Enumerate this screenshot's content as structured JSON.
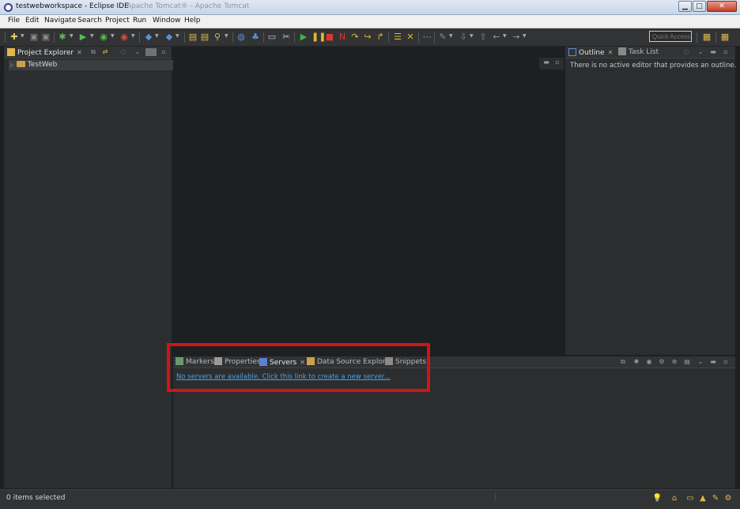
{
  "window": {
    "title": "testwebworkspace - Eclipse IDE",
    "background_title": "Apache Tomcat® - Apache Tomcat",
    "minimize_glyph": "▁",
    "maximize_glyph": "□",
    "close_glyph": "✕"
  },
  "menu": {
    "items": [
      {
        "label": "File"
      },
      {
        "label": "Edit"
      },
      {
        "label": "Navigate"
      },
      {
        "label": "Search"
      },
      {
        "label": "Project"
      },
      {
        "label": "Run"
      },
      {
        "label": "Window"
      },
      {
        "label": "Help"
      }
    ]
  },
  "toolbar": {
    "quick_access_placeholder": "Quick Access",
    "icons": [
      {
        "name": "new-icon",
        "glyph": "✚",
        "color": "#e9c46a"
      },
      {
        "name": "save-icon",
        "glyph": "▣",
        "color": "#8a8a8a"
      },
      {
        "name": "save-all-icon",
        "glyph": "▣",
        "color": "#8a8a8a"
      },
      {
        "name": "debug-icon",
        "glyph": "✱",
        "color": "#58b85a"
      },
      {
        "name": "run-icon",
        "glyph": "▶",
        "color": "#58b85a"
      },
      {
        "name": "coverage-icon",
        "glyph": "◉",
        "color": "#58b85a"
      },
      {
        "name": "external-tools-icon",
        "glyph": "◉",
        "color": "#d94f3a"
      },
      {
        "name": "new-server-icon",
        "glyph": "◆",
        "color": "#5d8fd6"
      },
      {
        "name": "new-class-icon",
        "glyph": "◆",
        "color": "#5d8fd6"
      },
      {
        "name": "open-type-icon",
        "glyph": "▤",
        "color": "#e0b84a"
      },
      {
        "name": "open-task-icon",
        "glyph": "▤",
        "color": "#e0b84a"
      },
      {
        "name": "search-icon",
        "glyph": "⚲",
        "color": "#e0b84a"
      },
      {
        "name": "globe-icon",
        "glyph": "◍",
        "color": "#5d8fd6"
      },
      {
        "name": "tools-icon",
        "glyph": "♣",
        "color": "#5d8fd6"
      },
      {
        "name": "console-icon",
        "glyph": "▭",
        "color": "#c8c8c8"
      },
      {
        "name": "pin-icon",
        "glyph": "✂",
        "color": "#c8c8c8"
      },
      {
        "name": "resume-icon",
        "glyph": "▶",
        "color": "#3cb54a"
      },
      {
        "name": "suspend-icon",
        "glyph": "❚❚",
        "color": "#e8b534"
      },
      {
        "name": "terminate-icon",
        "glyph": "■",
        "color": "#d93a2a"
      },
      {
        "name": "disconnect-icon",
        "glyph": "N",
        "color": "#d93a2a"
      },
      {
        "name": "step-into-icon",
        "glyph": "↷",
        "color": "#e8b534"
      },
      {
        "name": "step-over-icon",
        "glyph": "↪",
        "color": "#e8b534"
      },
      {
        "name": "step-return-icon",
        "glyph": "↱",
        "color": "#e8b534"
      },
      {
        "name": "drop-frame-icon",
        "glyph": "☰",
        "color": "#e8b534"
      },
      {
        "name": "use-step-filters-icon",
        "glyph": "✕",
        "color": "#e8b534"
      },
      {
        "name": "toggle-breakpoint-icon",
        "glyph": "⋯",
        "color": "#5dc0d6"
      },
      {
        "name": "annotation-icon",
        "glyph": "✎",
        "color": "#888888"
      },
      {
        "name": "next-annotation-icon",
        "glyph": "⇩",
        "color": "#888888"
      },
      {
        "name": "prev-annotation-icon",
        "glyph": "⇧",
        "color": "#888888"
      },
      {
        "name": "back-icon",
        "glyph": "←",
        "color": "#999999"
      },
      {
        "name": "forward-icon",
        "glyph": "→",
        "color": "#999999"
      },
      {
        "name": "open-perspective-icon",
        "glyph": "▦",
        "color": "#e0b84a"
      },
      {
        "name": "java-ee-perspective-icon",
        "glyph": "▦",
        "color": "#e0b84a"
      }
    ]
  },
  "project_explorer": {
    "tab_label": "Project Explorer",
    "close_glyph": "✕",
    "tree": [
      {
        "label": "TestWeb",
        "twisty": "▷"
      }
    ]
  },
  "outline": {
    "tabs": [
      {
        "label": "Outline"
      },
      {
        "label": "Task List"
      }
    ],
    "message": "There is no active editor that provides an outline."
  },
  "bottom_panel": {
    "tabs": [
      {
        "label": "Markers"
      },
      {
        "label": "Properties"
      },
      {
        "label": "Servers"
      },
      {
        "label": "Data Source Explorer"
      },
      {
        "label": "Snippets"
      }
    ],
    "active_tab": "Servers",
    "server_link": "No servers are available. Click this link to create a new server..."
  },
  "status": {
    "text": "0 items selected"
  },
  "colors": {
    "highlight": "#d01414",
    "link": "#4ea1e6",
    "panel": "#2b2d2f",
    "editor": "#1e1f21"
  }
}
